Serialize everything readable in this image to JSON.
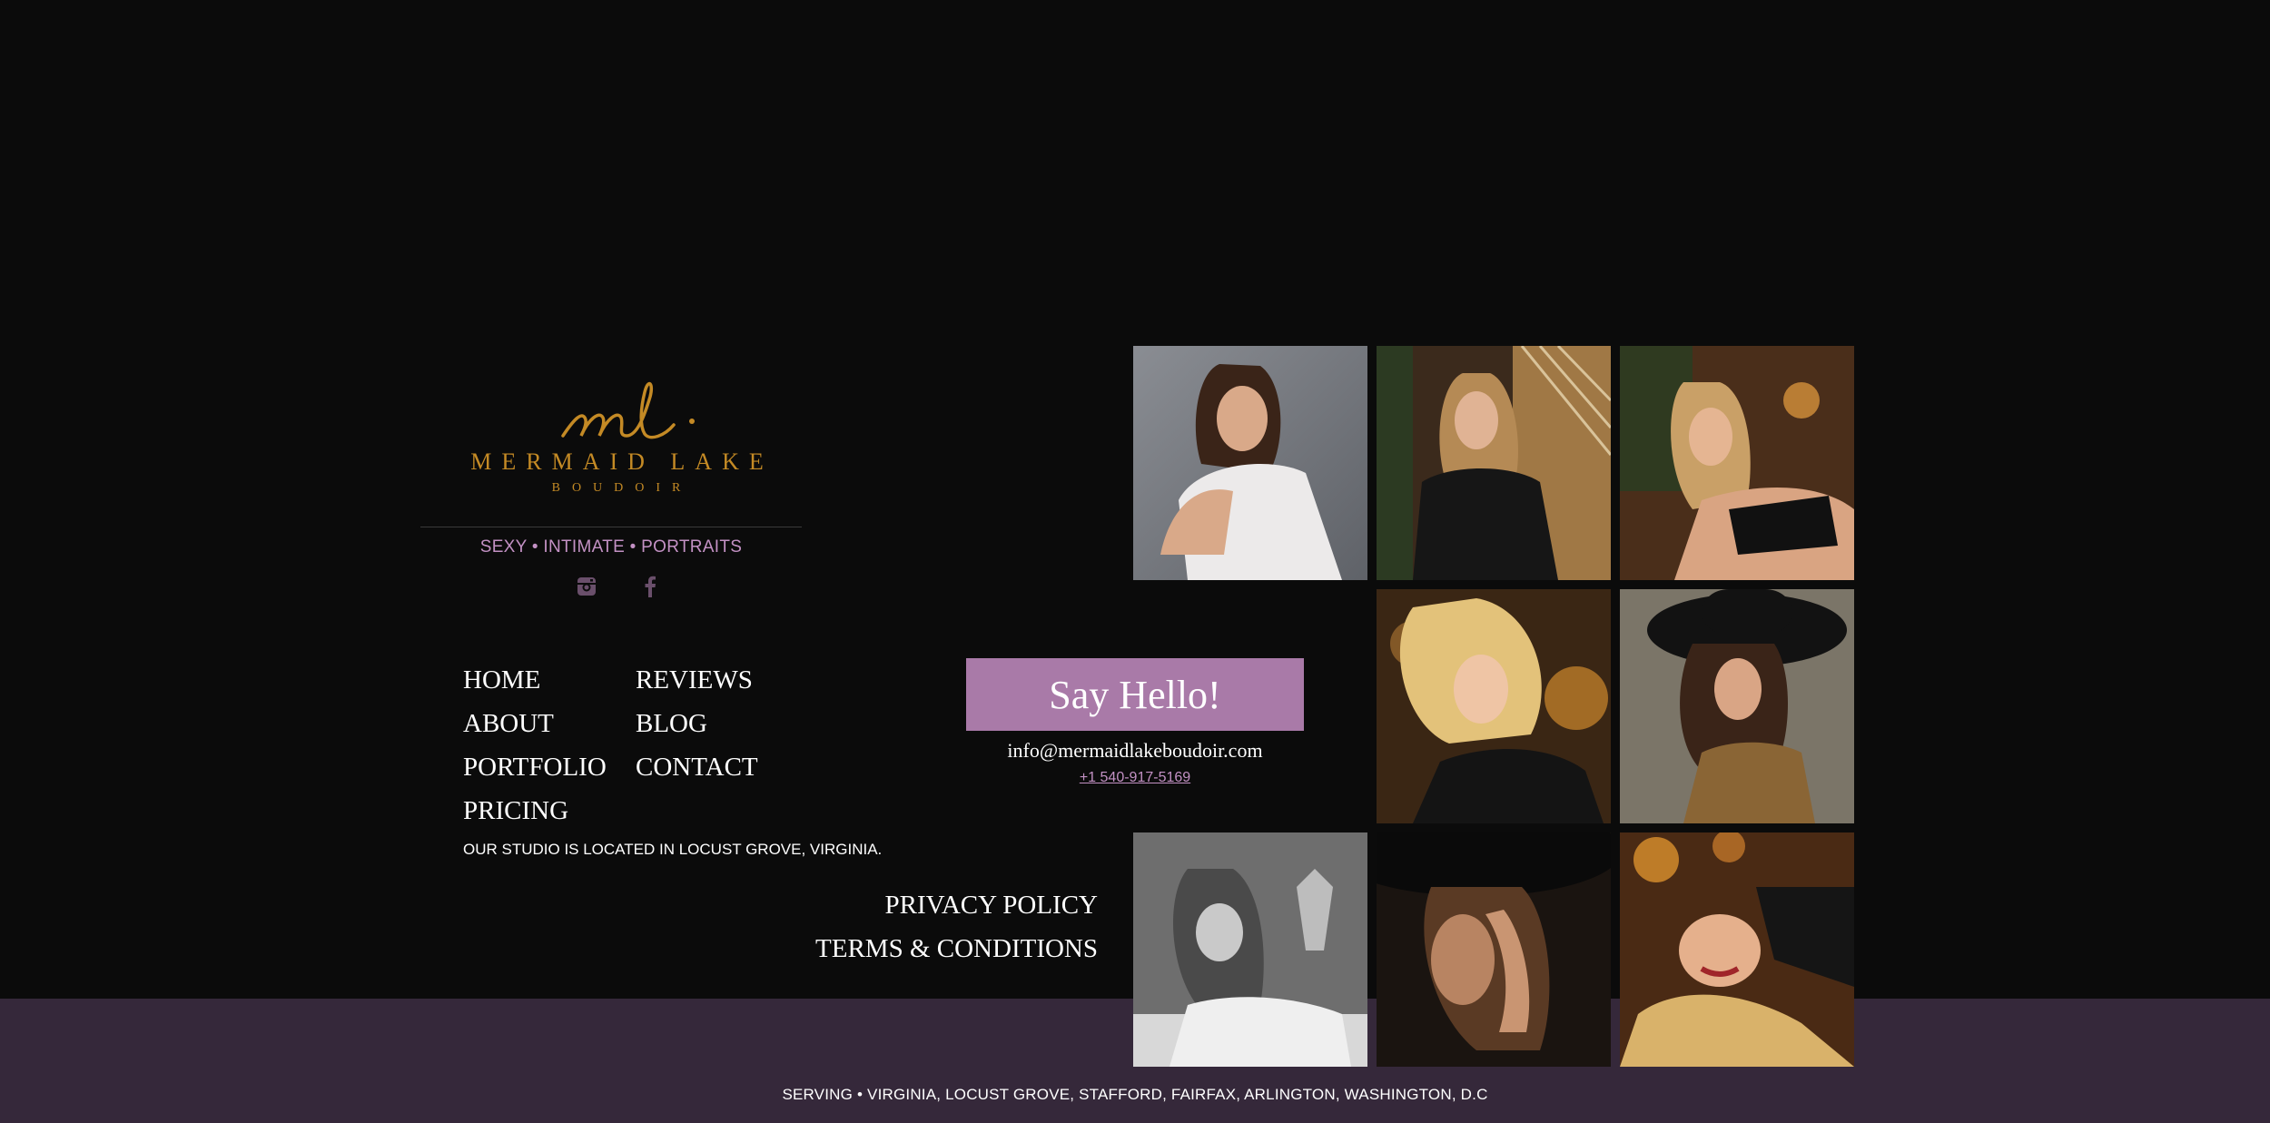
{
  "brand": {
    "monogram": "ml.",
    "name": "MERMAID LAKE",
    "subtitle": "BOUDOIR",
    "tagline": "SEXY • INTIMATE • PORTRAITS",
    "gold_color": "#c48a25",
    "accent_color": "#c391c4"
  },
  "social": [
    {
      "icon": "instagram-icon"
    },
    {
      "icon": "facebook-icon"
    }
  ],
  "nav": {
    "home": "HOME",
    "about": "ABOUT",
    "portfolio": "PORTFOLIO",
    "pricing": "PRICING",
    "reviews": "REVIEWS",
    "blog": "BLOG",
    "contact": "CONTACT"
  },
  "studio_note": "OUR STUDIO IS LOCATED IN LOCUST GROVE, VIRGINIA.",
  "legal": {
    "privacy": "PRIVACY POLICY",
    "terms": "TERMS & CONDITIONS"
  },
  "contact": {
    "cta": "Say Hello!",
    "email": "info@mermaidlakeboudoir.com",
    "phone": "+1 540-917-5169",
    "button_color": "#a97aa8"
  },
  "gallery": [
    {
      "name": "photo-white-robe"
    },
    {
      "name": "photo-leather-jacket"
    },
    {
      "name": "photo-black-lingerie"
    },
    {
      "name": "photo-blonde-curls"
    },
    {
      "name": "photo-black-hat-leopard"
    },
    {
      "name": "photo-black-white"
    },
    {
      "name": "photo-hat-closeup"
    },
    {
      "name": "photo-lying-smile"
    }
  ],
  "footer": {
    "serving": "SERVING • VIRGINIA, LOCUST GROVE, STAFFORD, FAIRFAX, ARLINGTON, WASHINGTON, D.C",
    "band_color": "#35283a"
  }
}
